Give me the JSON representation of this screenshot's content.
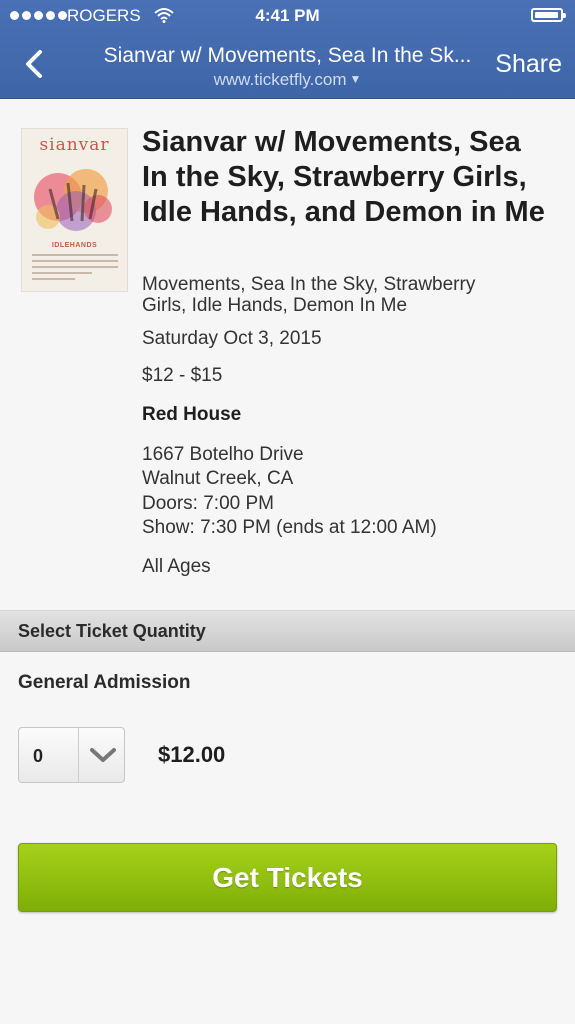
{
  "status": {
    "carrier": "ROGERS",
    "time": "4:41 PM"
  },
  "nav": {
    "title": "Sianvar w/ Movements, Sea In the Sk...",
    "url": "www.ticketfly.com",
    "share": "Share"
  },
  "poster": {
    "title": "sianvar",
    "band": "IDLEHANDS"
  },
  "event": {
    "title": "Sianvar w/ Movements, Sea In the Sky, Strawberry Girls, Idle Hands, and Demon in Me",
    "support": "Movements, Sea In the Sky, Strawberry Girls, Idle Hands, Demon In Me",
    "date": "Saturday Oct 3, 2015",
    "price_range": "$12 - $15",
    "venue": "Red House",
    "address1": "1667 Botelho Drive",
    "address2": "Walnut Creek, CA",
    "doors": "Doors: 7:00 PM",
    "show": "Show: 7:30 PM (ends at 12:00 AM)",
    "ages": "All Ages"
  },
  "tickets": {
    "section_label": "Select Ticket Quantity",
    "type": "General Admission",
    "quantity": "0",
    "price": "$12.00",
    "button": "Get Tickets"
  },
  "colors": {
    "topbar": "#4267b2",
    "button": "#8fbe0c",
    "poster_accent": "#c9574a"
  }
}
